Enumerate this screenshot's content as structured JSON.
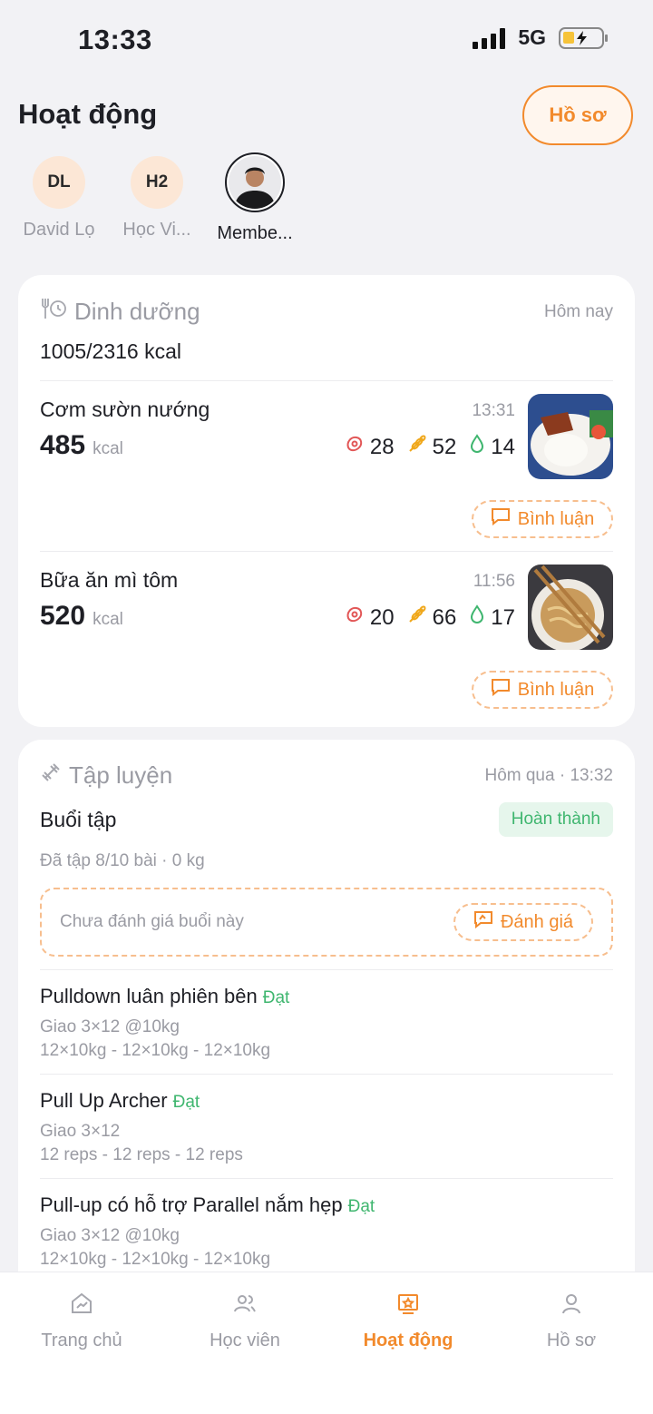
{
  "status_bar": {
    "time": "13:33",
    "network": "5G"
  },
  "header": {
    "title": "Hoạt động",
    "profile_button": "Hồ sơ"
  },
  "members": [
    {
      "initials": "DL",
      "name": "David Lọ",
      "active": false
    },
    {
      "initials": "H2",
      "name": "Học Vi...",
      "active": false
    },
    {
      "initials": "",
      "name": "Membe...",
      "active": true,
      "photo": true
    }
  ],
  "nutrition": {
    "title": "Dinh dưỡng",
    "date": "Hôm nay",
    "summary": "1005/2316 kcal",
    "meals": [
      {
        "name": "Cơm sườn nướng",
        "kcal": "485",
        "unit": "kcal",
        "time": "13:31",
        "protein": "28",
        "carbs": "52",
        "fat": "14",
        "comment": "Bình luận"
      },
      {
        "name": "Bữa ăn mì tôm",
        "kcal": "520",
        "unit": "kcal",
        "time": "11:56",
        "protein": "20",
        "carbs": "66",
        "fat": "17",
        "comment": "Bình luận"
      }
    ]
  },
  "workout": {
    "title": "Tập luyện",
    "date": "Hôm qua · 13:32",
    "session_title": "Buổi tập",
    "status": "Hoàn thành",
    "summary": "Đã tập 8/10 bài · 0 kg",
    "rating_prompt": "Chưa đánh giá buổi này",
    "rate_button": "Đánh giá",
    "exercises": [
      {
        "name": "Pulldown luân phiên bên",
        "tag": "Đạt",
        "plan": "Giao 3×12 @10kg",
        "sets": "12×10kg  -  12×10kg  -  12×10kg"
      },
      {
        "name": "Pull Up Archer",
        "tag": "Đạt",
        "plan": "Giao 3×12",
        "sets": "12 reps  -  12 reps  -  12 reps"
      },
      {
        "name": "Pull-up có hỗ trợ Parallel nắm hẹp",
        "tag": "Đạt",
        "plan": "Giao 3×12 @10kg",
        "sets": "12×10kg  -  12×10kg  -  12×10kg"
      }
    ]
  },
  "nav": {
    "items": [
      {
        "label": "Trang chủ",
        "icon": "home-chart-icon"
      },
      {
        "label": "Học viên",
        "icon": "users-icon"
      },
      {
        "label": "Hoạt động",
        "icon": "activity-star-icon",
        "active": true
      },
      {
        "label": "Hồ sơ",
        "icon": "person-icon"
      }
    ]
  },
  "colors": {
    "accent": "#F28A2C",
    "success": "#3FB66F",
    "muted": "#9A9BA3",
    "background": "#F2F2F5"
  }
}
